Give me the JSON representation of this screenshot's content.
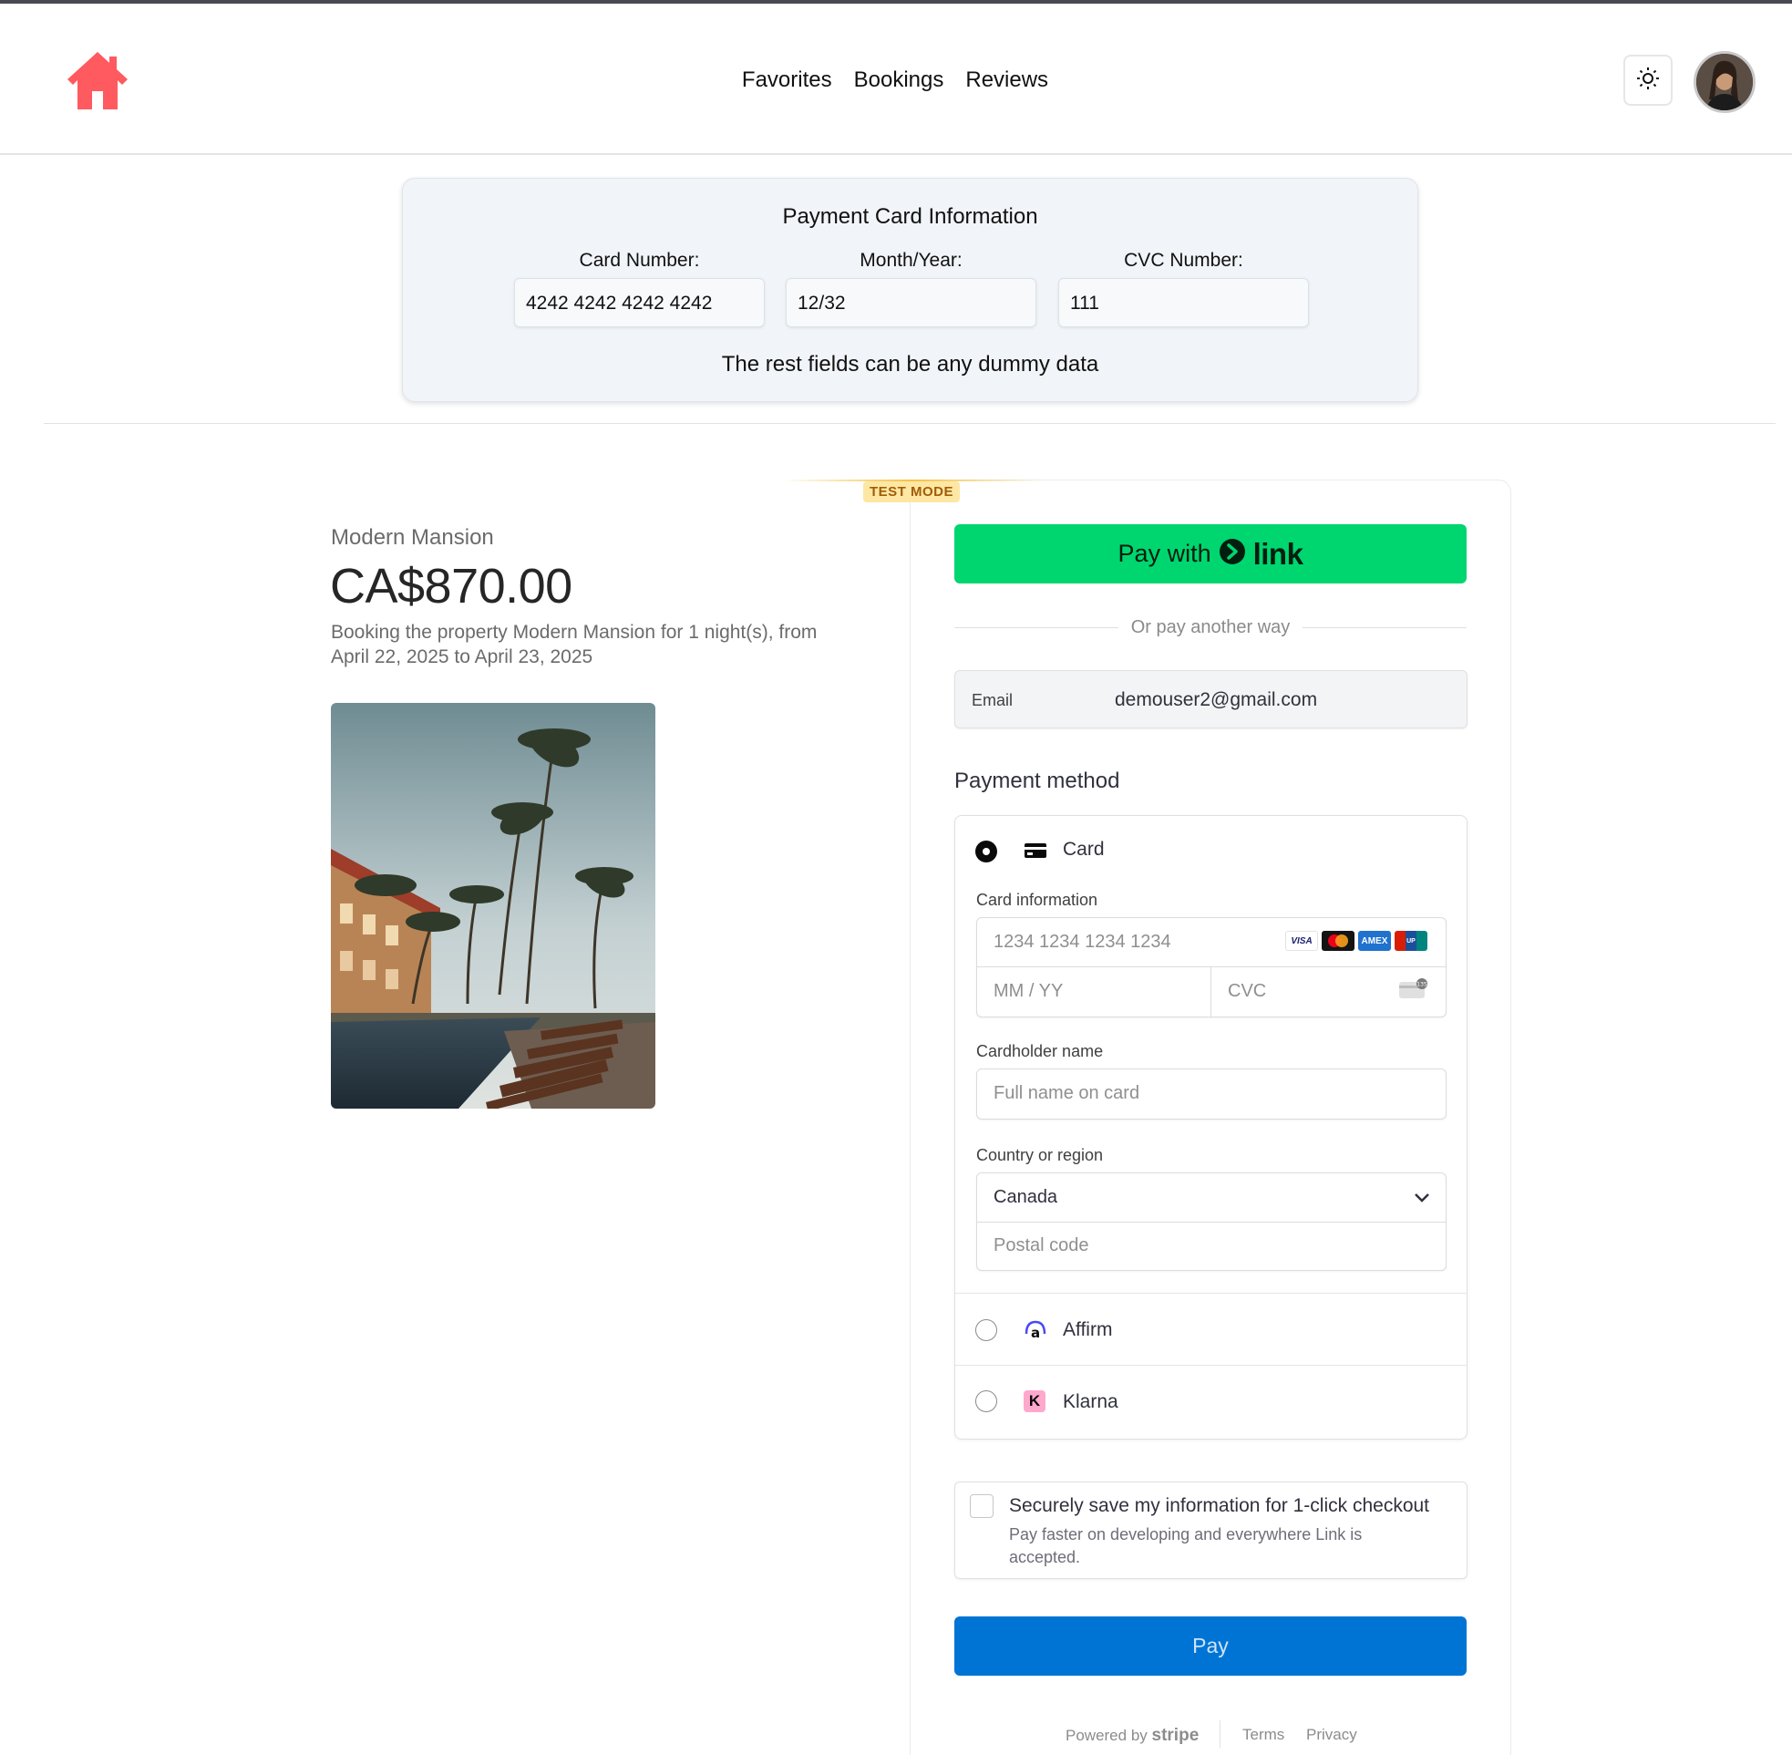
{
  "header": {
    "nav": [
      "Favorites",
      "Bookings",
      "Reviews"
    ]
  },
  "info_card": {
    "title": "Payment Card Information",
    "card_number_label": "Card Number:",
    "card_number_value": "4242 4242 4242 4242",
    "month_year_label": "Month/Year:",
    "month_year_value": "12/32",
    "cvc_label": "CVC Number:",
    "cvc_value": "111",
    "note": "The rest fields can be any dummy data"
  },
  "checkout": {
    "test_mode": "TEST MODE",
    "product_name": "Modern Mansion",
    "price": "CA$870.00",
    "description": "Booking the property Modern Mansion for 1 night(s), from April 22, 2025 to April 23, 2025",
    "link_button_prefix": "Pay with",
    "link_button_brand": "link",
    "or_text": "Or pay another way",
    "email_label": "Email",
    "email_value": "demouser2@gmail.com",
    "payment_method_title": "Payment method",
    "methods": {
      "card": "Card",
      "affirm": "Affirm",
      "klarna": "Klarna"
    },
    "card_info_label": "Card information",
    "card_number_placeholder": "1234 1234 1234 1234",
    "expiry_placeholder": "MM / YY",
    "cvc_placeholder": "CVC",
    "card_brands": [
      "VISA",
      "Mastercard",
      "AMEX",
      "UnionPay"
    ],
    "cardholder_label": "Cardholder name",
    "cardholder_placeholder": "Full name on card",
    "country_label": "Country or region",
    "country_value": "Canada",
    "postal_placeholder": "Postal code",
    "save_title": "Securely save my information for 1-click checkout",
    "save_subtitle": "Pay faster on developing and everywhere Link is accepted.",
    "pay_button": "Pay"
  },
  "footer": {
    "powered_by": "Powered by",
    "stripe": "stripe",
    "terms": "Terms",
    "privacy": "Privacy"
  },
  "colors": {
    "brand_red": "#ff5a5f",
    "link_green": "#00d66f",
    "pay_blue": "#0074d4",
    "test_mode_bg": "#fde7a3"
  },
  "icons": [
    "home-icon",
    "sun-icon",
    "card-icon",
    "affirm-icon",
    "klarna-icon",
    "chevron-down-icon",
    "link-arrow-icon",
    "cvc-card-icon"
  ]
}
